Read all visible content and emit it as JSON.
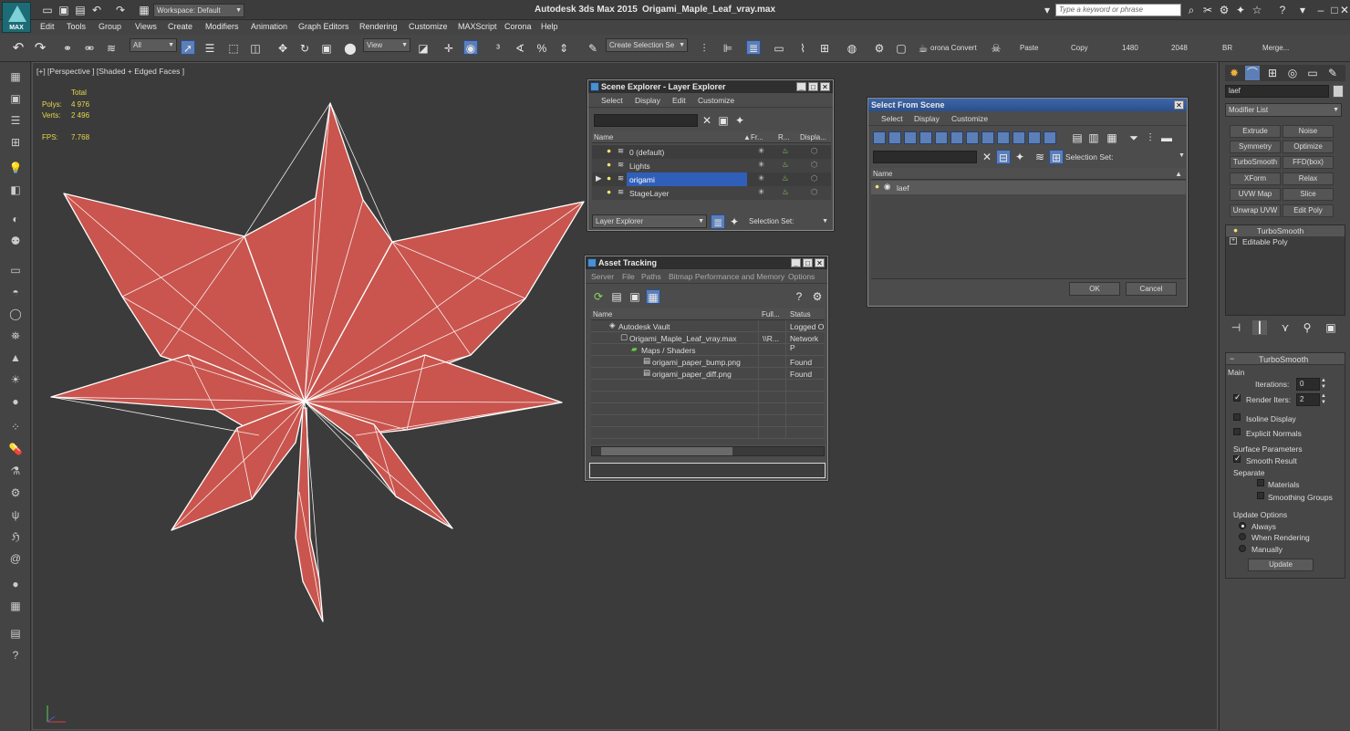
{
  "titlebar": {
    "workspace": "Workspace: Default",
    "title_app": "Autodesk 3ds Max  2015",
    "title_file": "Origami_Maple_Leaf_vray.max",
    "search_placeholder": "Type a keyword or phrase",
    "logo_text": "MAX"
  },
  "menu": [
    "Edit",
    "Tools",
    "Group",
    "Views",
    "Create",
    "Modifiers",
    "Animation",
    "Graph Editors",
    "Rendering",
    "Customize",
    "MAXScript",
    "Corona",
    "Help"
  ],
  "toolbar": {
    "filter": "All",
    "view": "View",
    "selection_set": "Create Selection Se",
    "corona_convert": "orona Convert",
    "paste": "Paste",
    "copy": "Copy",
    "w": "1480",
    "h": "2048",
    "br": "BR",
    "merge": "Merge..."
  },
  "viewport": {
    "label": "[+] [Perspective ] [Shaded + Edged Faces ]",
    "stats_header": "Total",
    "polys_label": "Polys:",
    "polys_value": "4 976",
    "verts_label": "Verts:",
    "verts_value": "2 496",
    "fps_label": "FPS:",
    "fps_value": "7.768",
    "leaf_color": "#c9554e"
  },
  "scene_explorer": {
    "title": "Scene Explorer - Layer Explorer",
    "menu": [
      "Select",
      "Display",
      "Edit",
      "Customize"
    ],
    "col_name": "Name",
    "col_fr": "Fr...",
    "col_r": "R...",
    "col_display": "Displa...",
    "layers": [
      "0 (default)",
      "Lights",
      "origami",
      "StageLayer"
    ],
    "selected": "origami",
    "footer_mode": "Layer Explorer",
    "footer_selset": "Selection Set:"
  },
  "asset_tracking": {
    "title": "Asset Tracking",
    "menu": [
      "Server",
      "File",
      "Paths",
      "Bitmap Performance and Memory",
      "Options"
    ],
    "col_name": "Name",
    "col_full": "Full...",
    "col_status": "Status",
    "rows": [
      {
        "name": "Autodesk Vault",
        "full": "",
        "status": "Logged O"
      },
      {
        "name": "Origami_Maple_Leaf_vray.max",
        "full": "\\\\R...",
        "status": "Network P"
      },
      {
        "name": "Maps / Shaders",
        "full": "",
        "status": ""
      },
      {
        "name": "origami_paper_bump.png",
        "full": "",
        "status": "Found"
      },
      {
        "name": "origami_paper_diff.png",
        "full": "",
        "status": "Found"
      }
    ]
  },
  "select_from_scene": {
    "title": "Select From Scene",
    "menu": [
      "Select",
      "Display",
      "Customize"
    ],
    "selset": "Selection Set:",
    "col_name": "Name",
    "item": "laef",
    "ok": "OK",
    "cancel": "Cancel"
  },
  "command_panel": {
    "object_name": "laef",
    "modifier_list": "Modifier List",
    "buttons": [
      "Extrude",
      "Noise",
      "Symmetry",
      "Optimize",
      "TurboSmooth",
      "FFD(box)",
      "XForm",
      "Relax",
      "UVW Map",
      "Slice",
      "Unwrap UVW",
      "Edit Poly"
    ],
    "stack": [
      "TurboSmooth",
      "Editable Poly"
    ],
    "rollout_title": "TurboSmooth",
    "main": "Main",
    "iterations_label": "Iterations:",
    "iterations": "0",
    "render_iters_label": "Render Iters:",
    "render_iters": "2",
    "isoline": "Isoline Display",
    "explicit": "Explicit Normals",
    "surface": "Surface Parameters",
    "smooth_result": "Smooth Result",
    "separate": "Separate",
    "materials": "Materials",
    "smoothing_groups": "Smoothing Groups",
    "update_options": "Update Options",
    "always": "Always",
    "when_rendering": "When Rendering",
    "manually": "Manually",
    "update": "Update"
  }
}
